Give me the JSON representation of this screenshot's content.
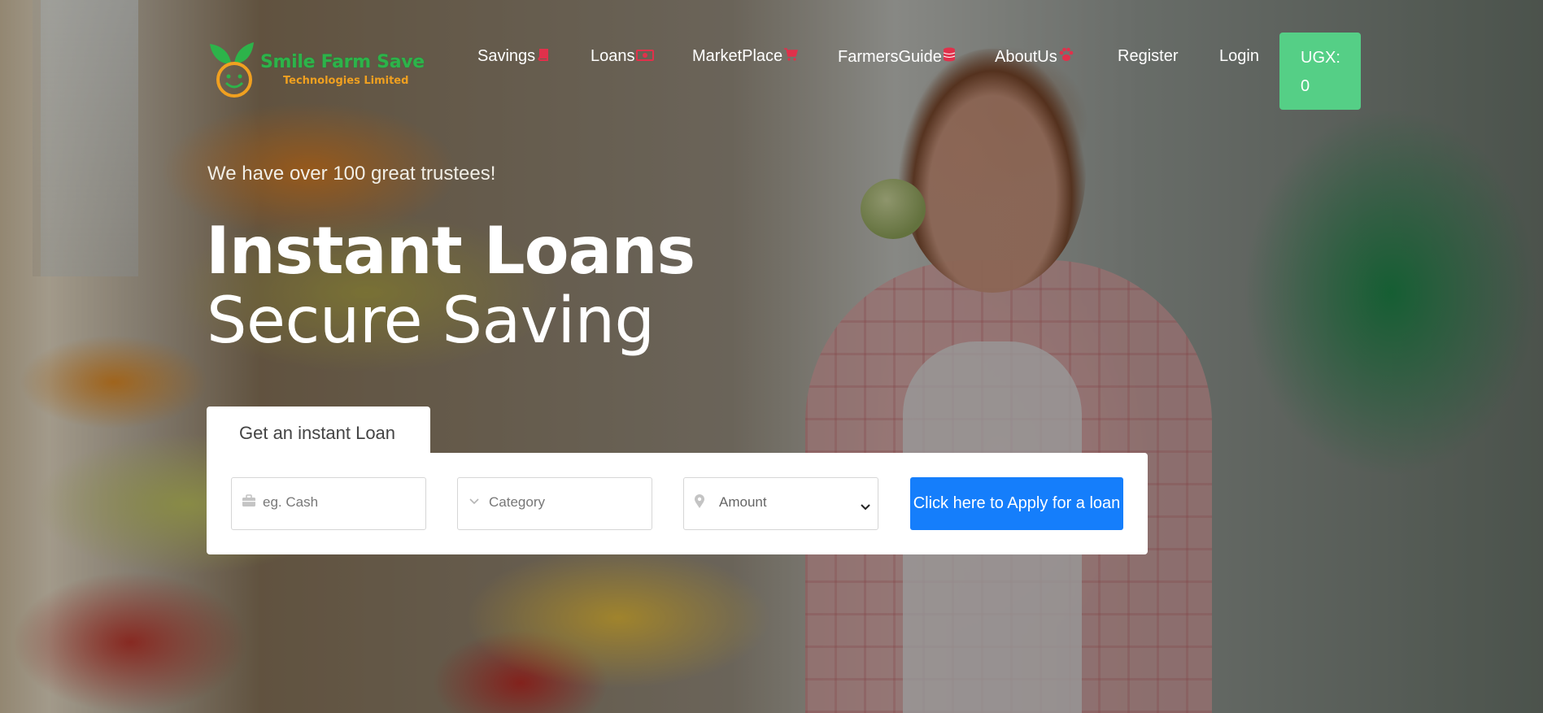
{
  "brand": {
    "name": "Smile Farm Save",
    "subtitle": "Technologies Limited",
    "name_color": "#2db34a",
    "subtitle_color": "#f0a020"
  },
  "nav": {
    "items": [
      {
        "label": "Savings",
        "icon": "book-icon"
      },
      {
        "label": "Loans",
        "icon": "money-bill-icon"
      },
      {
        "label": "MarketPlace",
        "icon": "cart-icon"
      },
      {
        "label": "FarmersGuide",
        "icon": "database-icon"
      },
      {
        "label": "AboutUs",
        "icon": "paw-icon"
      },
      {
        "label": "Register",
        "icon": ""
      },
      {
        "label": "Login",
        "icon": ""
      }
    ],
    "icon_color": "#e0314b",
    "balance": {
      "label": "UGX:",
      "value": "0",
      "color": "#55cf86"
    }
  },
  "hero": {
    "tagline": "We have over 100 great trustees!",
    "headline_bold": "Instant Loans",
    "headline_light": "Secure Saving"
  },
  "loan_form": {
    "tab_label": "Get an instant Loan",
    "type_placeholder": "eg. Cash",
    "type_icon": "briefcase-icon",
    "category_placeholder": "Category",
    "category_icon": "chevron-down-icon",
    "amount_selected": "Amount",
    "amount_icon": "map-pin-icon",
    "apply_label": "Click here to Apply for a loan",
    "apply_color": "#157efb"
  }
}
